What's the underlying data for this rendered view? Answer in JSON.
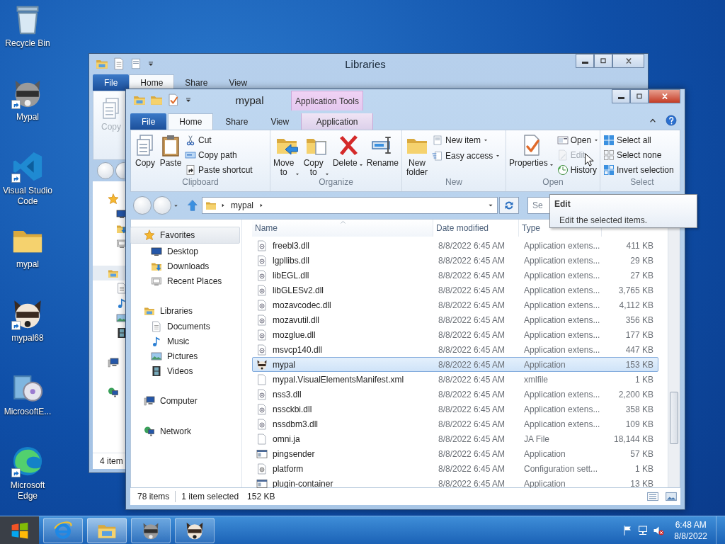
{
  "desktop_icons": [
    {
      "label": "Recycle Bin",
      "kind": "recycle",
      "shortcut": false
    },
    {
      "label": "Mypal",
      "kind": "raccoon",
      "shortcut": true
    },
    {
      "label": "Visual Studio Code",
      "kind": "vscode",
      "shortcut": true
    },
    {
      "label": "mypal",
      "kind": "folder",
      "shortcut": false
    },
    {
      "label": "mypal68",
      "kind": "raccoon2",
      "shortcut": true
    },
    {
      "label": "MicrosoftE...",
      "kind": "installer",
      "shortcut": false
    },
    {
      "label": "Microsoft Edge",
      "kind": "edge",
      "shortcut": true
    }
  ],
  "back_window": {
    "title": "Libraries",
    "tabs": [
      {
        "label": "File",
        "kind": "file",
        "selected": false
      },
      {
        "label": "Home",
        "kind": "tab",
        "selected": true
      },
      {
        "label": "Share",
        "kind": "tab",
        "selected": false
      },
      {
        "label": "View",
        "kind": "tab",
        "selected": false
      }
    ],
    "copy_button": {
      "label": "Copy",
      "disabled": true
    },
    "status": "4 item"
  },
  "window": {
    "title": "mypal",
    "context_group": "Application Tools",
    "tabs": [
      {
        "label": "File",
        "kind": "file",
        "selected": false
      },
      {
        "label": "Home",
        "kind": "tab",
        "selected": true
      },
      {
        "label": "Share",
        "kind": "tab",
        "selected": false
      },
      {
        "label": "View",
        "kind": "tab",
        "selected": false
      },
      {
        "label": "Application",
        "kind": "context",
        "selected": false
      }
    ],
    "ribbon": [
      {
        "label": "Clipboard",
        "large": [
          {
            "label": "Copy",
            "kind": "copy",
            "dropdown": false
          },
          {
            "label": "Paste",
            "kind": "paste",
            "dropdown": false
          }
        ],
        "small": [
          {
            "label": "Cut",
            "kind": "cut",
            "dropdown": false,
            "disabled": false
          },
          {
            "label": "Copy path",
            "kind": "copypath",
            "dropdown": false,
            "disabled": false
          },
          {
            "label": "Paste shortcut",
            "kind": "pasteshortcut",
            "dropdown": false,
            "disabled": false
          }
        ]
      },
      {
        "label": "Organize",
        "large": [
          {
            "label": "Move to",
            "kind": "move",
            "dropdown": true
          },
          {
            "label": "Copy to",
            "kind": "copyto",
            "dropdown": true
          },
          {
            "label": "Delete",
            "kind": "delete",
            "dropdown": true
          },
          {
            "label": "Rename",
            "kind": "rename",
            "dropdown": false
          }
        ]
      },
      {
        "label": "New",
        "large": [
          {
            "label": "New folder",
            "kind": "newfolder",
            "dropdown": false
          }
        ],
        "small": [
          {
            "label": "New item",
            "kind": "newitem",
            "dropdown": true,
            "disabled": false
          },
          {
            "label": "Easy access",
            "kind": "easyaccess",
            "dropdown": true,
            "disabled": false
          }
        ]
      },
      {
        "label": "Open",
        "large": [
          {
            "label": "Properties",
            "kind": "properties",
            "dropdown": true
          }
        ],
        "small": [
          {
            "label": "Open",
            "kind": "open",
            "dropdown": true,
            "disabled": false
          },
          {
            "label": "Edit",
            "kind": "edit",
            "dropdown": false,
            "disabled": true
          },
          {
            "label": "History",
            "kind": "history",
            "dropdown": false,
            "disabled": false
          }
        ]
      },
      {
        "label": "Select",
        "small": [
          {
            "label": "Select all",
            "kind": "selectall",
            "dropdown": false,
            "disabled": false
          },
          {
            "label": "Select none",
            "kind": "selectnone",
            "dropdown": false,
            "disabled": false
          },
          {
            "label": "Invert selection",
            "kind": "invert",
            "dropdown": false,
            "disabled": false
          }
        ]
      }
    ],
    "address": {
      "path": [
        "mypal"
      ]
    },
    "search": {
      "placeholder": "Se"
    },
    "nav": [
      {
        "label": "Favorites",
        "kind": "star",
        "selected": true,
        "children": [
          {
            "label": "Desktop",
            "kind": "desktop",
            "selected": false
          },
          {
            "label": "Downloads",
            "kind": "downloads",
            "selected": false
          },
          {
            "label": "Recent Places",
            "kind": "recent",
            "selected": false
          }
        ]
      },
      {
        "label": "Libraries",
        "kind": "library",
        "selected": false,
        "children": [
          {
            "label": "Documents",
            "kind": "document",
            "selected": false
          },
          {
            "label": "Music",
            "kind": "music",
            "selected": false
          },
          {
            "label": "Pictures",
            "kind": "pictures",
            "selected": false
          },
          {
            "label": "Videos",
            "kind": "videos",
            "selected": false
          }
        ]
      },
      {
        "label": "Computer",
        "kind": "computer",
        "selected": false
      },
      {
        "label": "Network",
        "kind": "network",
        "selected": false
      }
    ],
    "columns": [
      {
        "label": "Name",
        "sorted": true
      },
      {
        "label": "Date modified",
        "sorted": false
      },
      {
        "label": "Type",
        "sorted": false
      }
    ],
    "rows": [
      {
        "name": "freebl3.dll",
        "date": "8/8/2022 6:45 AM",
        "type": "Application extens...",
        "size": "411 KB",
        "kind": "dll",
        "selected": false
      },
      {
        "name": "lgpllibs.dll",
        "date": "8/8/2022 6:45 AM",
        "type": "Application extens...",
        "size": "29 KB",
        "kind": "dll",
        "selected": false
      },
      {
        "name": "libEGL.dll",
        "date": "8/8/2022 6:45 AM",
        "type": "Application extens...",
        "size": "27 KB",
        "kind": "dll",
        "selected": false
      },
      {
        "name": "libGLESv2.dll",
        "date": "8/8/2022 6:45 AM",
        "type": "Application extens...",
        "size": "3,765 KB",
        "kind": "dll",
        "selected": false
      },
      {
        "name": "mozavcodec.dll",
        "date": "8/8/2022 6:45 AM",
        "type": "Application extens...",
        "size": "4,112 KB",
        "kind": "dll",
        "selected": false
      },
      {
        "name": "mozavutil.dll",
        "date": "8/8/2022 6:45 AM",
        "type": "Application extens...",
        "size": "356 KB",
        "kind": "dll",
        "selected": false
      },
      {
        "name": "mozglue.dll",
        "date": "8/8/2022 6:45 AM",
        "type": "Application extens...",
        "size": "177 KB",
        "kind": "dll",
        "selected": false
      },
      {
        "name": "msvcp140.dll",
        "date": "8/8/2022 6:45 AM",
        "type": "Application extens...",
        "size": "447 KB",
        "kind": "dll",
        "selected": false
      },
      {
        "name": "mypal",
        "date": "8/8/2022 6:45 AM",
        "type": "Application",
        "size": "153 KB",
        "kind": "raccoon2",
        "selected": true
      },
      {
        "name": "mypal.VisualElementsManifest.xml",
        "date": "8/8/2022 6:45 AM",
        "type": "xmlfile",
        "size": "1 KB",
        "kind": "page",
        "selected": false
      },
      {
        "name": "nss3.dll",
        "date": "8/8/2022 6:45 AM",
        "type": "Application extens...",
        "size": "2,200 KB",
        "kind": "dll",
        "selected": false
      },
      {
        "name": "nssckbi.dll",
        "date": "8/8/2022 6:45 AM",
        "type": "Application extens...",
        "size": "358 KB",
        "kind": "dll",
        "selected": false
      },
      {
        "name": "nssdbm3.dll",
        "date": "8/8/2022 6:45 AM",
        "type": "Application extens...",
        "size": "109 KB",
        "kind": "dll",
        "selected": false
      },
      {
        "name": "omni.ja",
        "date": "8/8/2022 6:45 AM",
        "type": "JA File",
        "size": "18,144 KB",
        "kind": "page",
        "selected": false
      },
      {
        "name": "pingsender",
        "date": "8/8/2022 6:45 AM",
        "type": "Application",
        "size": "57 KB",
        "kind": "app",
        "selected": false
      },
      {
        "name": "platform",
        "date": "8/8/2022 6:45 AM",
        "type": "Configuration sett...",
        "size": "1 KB",
        "kind": "config",
        "selected": false
      },
      {
        "name": "plugin-container",
        "date": "8/8/2022 6:45 AM",
        "type": "Application",
        "size": "13 KB",
        "kind": "app",
        "selected": false
      }
    ],
    "status": {
      "count": "78 items",
      "selection": "1 item selected",
      "size": "152 KB"
    }
  },
  "tooltip": {
    "title": "Edit",
    "text": "Edit the selected items."
  },
  "taskbar": {
    "apps": [
      {
        "kind": "ie",
        "active": false
      },
      {
        "kind": "explorer",
        "active": true
      },
      {
        "kind": "raccoon",
        "active": false
      },
      {
        "kind": "raccoon2",
        "active": false
      }
    ],
    "time": "6:48 AM",
    "date": "8/8/2022"
  }
}
